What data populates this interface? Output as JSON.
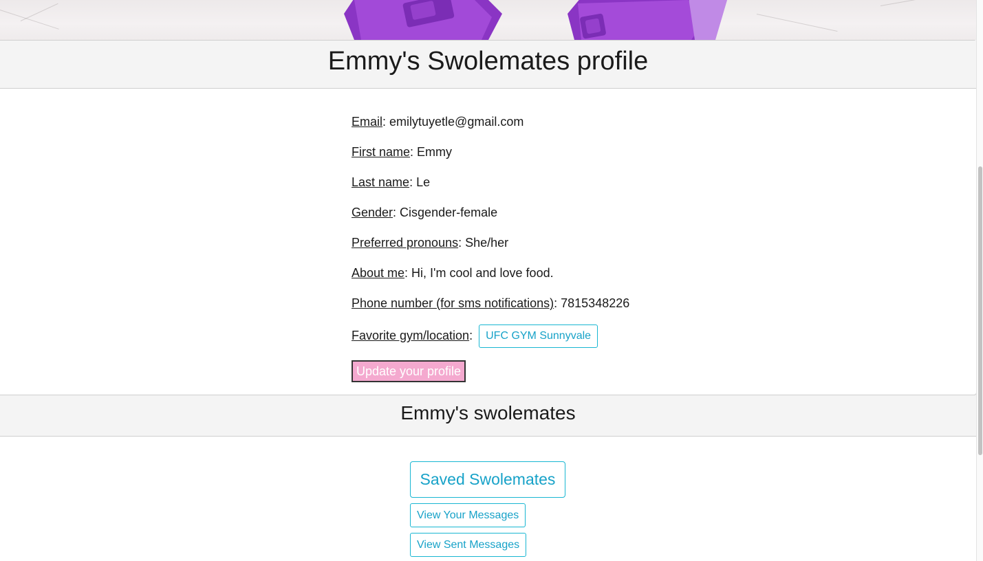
{
  "profile": {
    "title": "Emmy's Swolemates profile",
    "fields": [
      {
        "label": "Email",
        "value": ": emilytuyetle@gmail.com"
      },
      {
        "label": "First name",
        "value": ": Emmy"
      },
      {
        "label": "Last name",
        "value": ": Le"
      },
      {
        "label": "Gender",
        "value": ": Cisgender-female"
      },
      {
        "label": "Preferred pronouns",
        "value": ": She/her"
      },
      {
        "label": "About me",
        "value": ": Hi, I'm cool and love food."
      },
      {
        "label": "Phone number (for sms notifications)",
        "value": ": 7815348226"
      }
    ],
    "gym": {
      "label": "Favorite gym/location",
      "separator": ":",
      "button_label": "UFC GYM Sunnyvale"
    },
    "update_button_label": "Update your profile"
  },
  "swolemates": {
    "title": "Emmy's swolemates",
    "saved_button_label": "Saved Swolemates",
    "view_messages_label": "View Your Messages",
    "view_sent_label": "View Sent Messages"
  },
  "colors": {
    "accent": "#17b6d2",
    "update_button_bg": "#f4a9cf",
    "header_bg": "#f4f4f4",
    "dumbbell": "#9b3fd1"
  },
  "banner": {
    "image_description_icon": "dumbbell-photo"
  }
}
